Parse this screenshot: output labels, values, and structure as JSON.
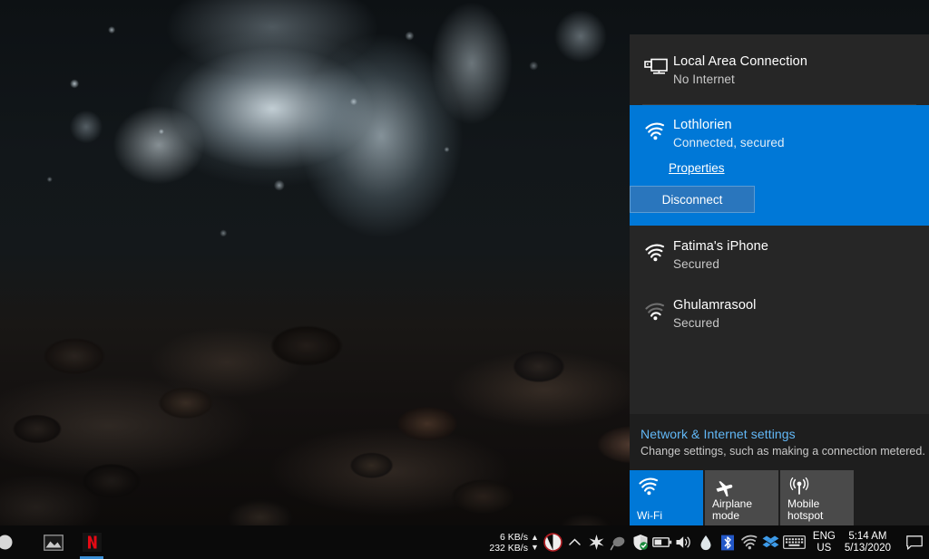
{
  "flyout": {
    "ethernet": {
      "icon": "ethernet-icon",
      "name": "Local Area Connection",
      "status": "No Internet"
    },
    "networks": [
      {
        "icon": "wifi-icon",
        "name": "Lothlorien",
        "status": "Connected, secured",
        "selected": true,
        "signal": 4,
        "properties_label": "Properties",
        "disconnect_label": "Disconnect"
      },
      {
        "icon": "wifi-icon",
        "name": "Fatima's iPhone",
        "status": "Secured",
        "selected": false,
        "signal": 4
      },
      {
        "icon": "wifi-icon",
        "name": "Ghulamrasool",
        "status": "Secured",
        "selected": false,
        "signal": 2
      }
    ],
    "settings": {
      "link_label": "Network & Internet settings",
      "description": "Change settings, such as making a connection metered.",
      "link_color": "#62b8f7"
    },
    "quick_actions": [
      {
        "label": "Wi-Fi",
        "icon": "wifi-icon",
        "active": true
      },
      {
        "label": "Airplane mode",
        "icon": "airplane-icon",
        "active": false
      },
      {
        "label": "Mobile hotspot",
        "icon": "hotspot-icon",
        "active": false
      }
    ],
    "accent_color": "#0078d7",
    "background_color": "#262626"
  },
  "taskbar": {
    "start": {
      "icon": "windows-start-icon"
    },
    "apps": [
      {
        "name": "photos-app",
        "icon": "photo-icon",
        "active": false
      },
      {
        "name": "netflix-app",
        "icon": "netflix-icon",
        "active": true,
        "glyph": "N"
      }
    ],
    "network_speed": {
      "upload": "6 KB/s",
      "download": "232 KB/s",
      "up_arrow": "▲",
      "down_arrow": "▼"
    },
    "tray_icons": [
      {
        "name": "f-lux-icon"
      },
      {
        "name": "show-hidden-icons-chevron"
      },
      {
        "name": "graphics-settings-icon"
      },
      {
        "name": "mouse-utility-icon"
      },
      {
        "name": "windows-defender-icon"
      },
      {
        "name": "battery-icon"
      },
      {
        "name": "volume-icon"
      },
      {
        "name": "water-drop-icon"
      },
      {
        "name": "bluetooth-icon"
      },
      {
        "name": "wifi-icon"
      },
      {
        "name": "dropbox-icon"
      },
      {
        "name": "touch-keyboard-icon"
      }
    ],
    "language": {
      "line1": "ENG",
      "line2": "US"
    },
    "clock": {
      "time": "5:14 AM",
      "date": "5/13/2020"
    },
    "action_center": {
      "icon": "notification-icon"
    }
  }
}
